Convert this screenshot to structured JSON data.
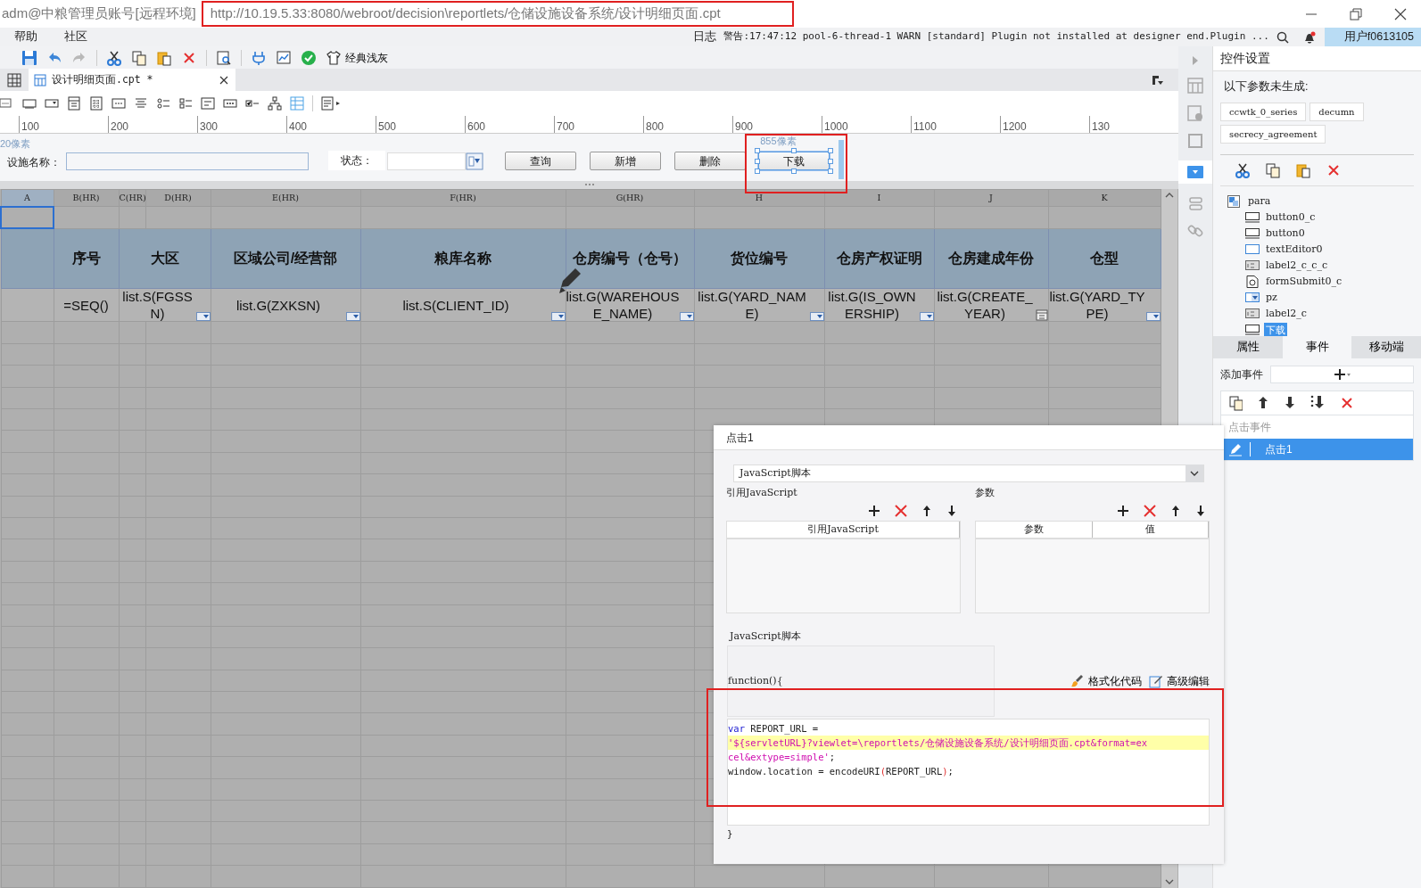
{
  "window": {
    "title": "adm@中粮管理员账号[远程环境]",
    "url": "http://10.19.5.33:8080/webroot/decision\\reportlets/仓储设施设备系统/设计明细页面.cpt"
  },
  "menu": [
    {
      "label": "帮助"
    },
    {
      "label": "社区"
    }
  ],
  "status_bar": {
    "log": "日志",
    "warning": "警告:17:47:12 pool-6-thread-1 WARN [standard] Plugin not installed at designer end.Plugin ...",
    "user": "用户f0613105"
  },
  "toolbar": {
    "theme": "经典浅灰"
  },
  "file_tabs": [
    {
      "label": "设计明细页面.cpt *",
      "selected": true
    }
  ],
  "ruler": {
    "ticks": [
      "100",
      "200",
      "300",
      "400",
      "500",
      "600",
      "700",
      "800",
      "900",
      "1000",
      "1100",
      "1200",
      "130"
    ]
  },
  "parameter_pane": {
    "left_hint": "20像素",
    "fields": [
      {
        "label": "设施名称：",
        "kind": "text"
      },
      {
        "label": "状态：",
        "kind": "combo"
      }
    ],
    "buttons": [
      {
        "label": "查询",
        "selected": false
      },
      {
        "label": "新增",
        "selected": false
      },
      {
        "label": "删除",
        "selected": false
      },
      {
        "label": "下载",
        "selected": true,
        "size_hint": "855像素"
      }
    ]
  },
  "sheet": {
    "columns": [
      "A",
      "B(HR)",
      "C(HR)",
      "D(HR)",
      "E(HR)",
      "F(HR)",
      "G(HR)",
      "H",
      "I",
      "J",
      "K"
    ],
    "header_row": [
      {
        "text": "序号",
        "merged": false
      },
      {
        "text": "大区",
        "merged": true
      },
      {
        "text": "区域公司/经营部",
        "merged": false
      },
      {
        "text": "粮库名称",
        "merged": false
      },
      {
        "text": "仓房编号（仓号）",
        "merged": false
      },
      {
        "text": "货位编号",
        "merged": false
      },
      {
        "text": "仓房产权证明",
        "merged": false
      },
      {
        "text": "仓房建成年份",
        "merged": false
      },
      {
        "text": "仓型",
        "merged": false
      }
    ],
    "formula_row": [
      {
        "text": "=SEQ()",
        "merged": false,
        "kind": "plain"
      },
      {
        "text": "list.S(FGSSN)",
        "merged": true,
        "kind": "combo"
      },
      {
        "text": "list.G(ZXKSN)",
        "merged": false,
        "kind": "combo"
      },
      {
        "text": "list.S(CLIENT_ID)",
        "merged": false,
        "kind": "combo"
      },
      {
        "text": "list.G(WAREHOUSE_NAME)",
        "merged": false,
        "kind": "combo"
      },
      {
        "text": "list.G(YARD_NAME)",
        "merged": false,
        "kind": "combo"
      },
      {
        "text": "list.G(IS_OWNERSHIP)",
        "merged": false,
        "kind": "combo"
      },
      {
        "text": "list.G(CREATE_YEAR)",
        "merged": false,
        "kind": "date"
      },
      {
        "text": "list.G(YARD_TYPE)",
        "merged": false,
        "kind": "combo"
      }
    ]
  },
  "widget_settings": {
    "title": "控件设置",
    "notice": "以下参数未生成:",
    "missing_params": [
      "ccwtk_0_series",
      "decumn",
      "secrecy_agreement"
    ],
    "tree": {
      "label": "para",
      "kind": "form",
      "children": [
        {
          "label": "button0_c",
          "kind": "button",
          "selected": false
        },
        {
          "label": "button0",
          "kind": "button",
          "selected": false
        },
        {
          "label": "textEditor0",
          "kind": "text",
          "selected": false
        },
        {
          "label": "label2_c_c_c",
          "kind": "label",
          "selected": false
        },
        {
          "label": "formSubmit0_c",
          "kind": "submit",
          "selected": false
        },
        {
          "label": "pz",
          "kind": "combo",
          "selected": false
        },
        {
          "label": "label2_c",
          "kind": "label",
          "selected": false
        },
        {
          "label": "下载",
          "kind": "button",
          "selected": true
        }
      ]
    },
    "tabs": [
      {
        "label": "属性",
        "selected": false
      },
      {
        "label": "事件",
        "selected": true
      },
      {
        "label": "移动端",
        "selected": false
      }
    ],
    "add_event": "添加事件",
    "event_group": "点击事件",
    "events": [
      {
        "label": "点击1",
        "selected": true
      }
    ]
  },
  "event_dialog": {
    "title": "点击1",
    "type": "JavaScript脚本",
    "imports": {
      "title": "引用JavaScript",
      "columns": [
        "引用JavaScript"
      ]
    },
    "parameters": {
      "title": "参数",
      "columns": [
        "参数",
        "值"
      ]
    },
    "script": {
      "title": "JavaScript脚本",
      "header": "function(){",
      "actions": [
        {
          "label": "格式化代码",
          "kind": "format"
        },
        {
          "label": "高级编辑",
          "kind": "edit"
        }
      ],
      "lines": [
        {
          "highlighted": false,
          "tokens": [
            {
              "kind": "keyword",
              "text": "var"
            },
            {
              "kind": "plain",
              "text": " REPORT_URL ="
            }
          ]
        },
        {
          "highlighted": true,
          "tokens": [
            {
              "kind": "string",
              "text": "'${servletURL}?viewlet=\\reportlets/仓储设施设备系统/设计明细页面.cpt&format=ex"
            }
          ]
        },
        {
          "highlighted": false,
          "tokens": [
            {
              "kind": "string",
              "text": "cel&extype=simple'"
            },
            {
              "kind": "plain",
              "text": ";"
            }
          ]
        },
        {
          "highlighted": false,
          "tokens": [
            {
              "kind": "plain",
              "text": "window.location = encodeURI"
            },
            {
              "kind": "paren",
              "text": "("
            },
            {
              "kind": "plain",
              "text": "REPORT_URL"
            },
            {
              "kind": "paren",
              "text": ")"
            },
            {
              "kind": "plain",
              "text": ";"
            }
          ]
        }
      ],
      "footer": "}"
    }
  }
}
